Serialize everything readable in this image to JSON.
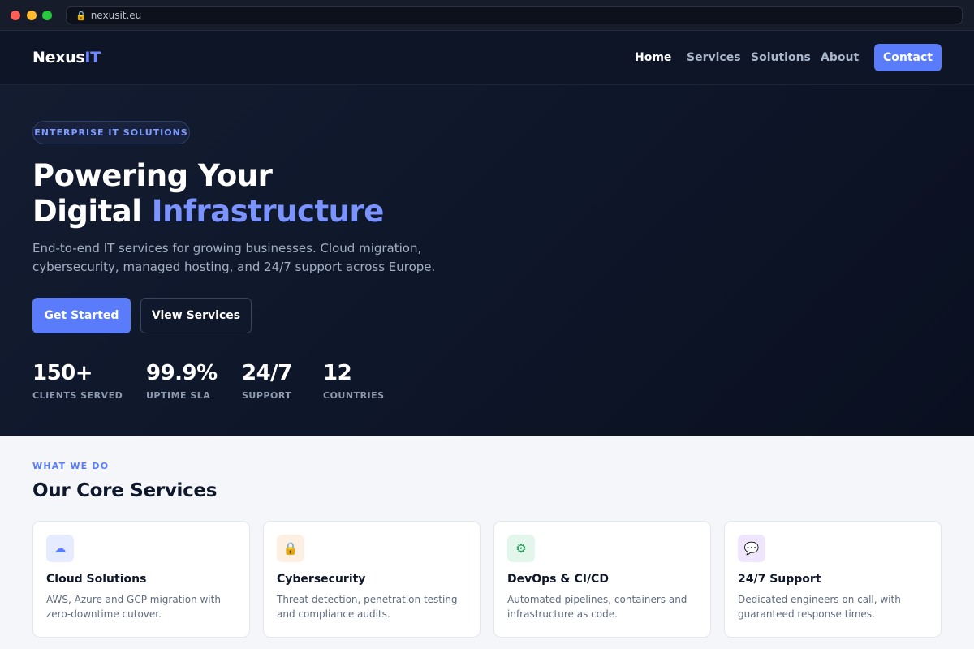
{
  "browser": {
    "url": "nexusit.eu"
  },
  "nav": {
    "logo_main": "Nexus",
    "logo_accent": "IT",
    "links": [
      {
        "label": "Home",
        "active": true
      },
      {
        "label": "Services",
        "active": false
      },
      {
        "label": "Solutions",
        "active": false
      },
      {
        "label": "About",
        "active": false
      }
    ],
    "cta": "Contact"
  },
  "hero": {
    "badge": "ENTERPRISE IT SOLUTIONS",
    "headline_line1": "Powering Your",
    "headline_line2_plain": "Digital ",
    "headline_line2_accent": "Infrastructure",
    "lead": "End-to-end IT services for growing businesses. Cloud migration, cybersecurity, managed hosting, and 24/7 support across Europe.",
    "primary_button": "Get Started",
    "secondary_button": "View Services",
    "stats": [
      {
        "value": "150+",
        "label": "CLIENTS SERVED"
      },
      {
        "value": "99.9%",
        "label": "UPTIME SLA"
      },
      {
        "value": "24/7",
        "label": "SUPPORT"
      },
      {
        "value": "12",
        "label": "COUNTRIES"
      }
    ]
  },
  "services": {
    "eyebrow": "WHAT WE DO",
    "title": "Our Core Services",
    "cards": [
      {
        "icon": "cloud-icon",
        "glyph": "☁",
        "icon_bg": "#e6ebff",
        "icon_color": "#5b7cfa",
        "title": "Cloud Solutions",
        "description": "AWS, Azure and GCP migration with zero-downtime cutover."
      },
      {
        "icon": "lock-icon",
        "glyph": "🔒",
        "icon_bg": "#fdefe2",
        "icon_color": "#e0902a",
        "title": "Cybersecurity",
        "description": "Threat detection, penetration testing and compliance audits."
      },
      {
        "icon": "gear-icon",
        "glyph": "⚙",
        "icon_bg": "#e3f6ec",
        "icon_color": "#1f9d57",
        "title": "DevOps & CI/CD",
        "description": "Automated pipelines, containers and infrastructure as code."
      },
      {
        "icon": "speech-bubble-icon",
        "glyph": "💬",
        "icon_bg": "#efe6fd",
        "icon_color": "#8b5cf6",
        "title": "24/7 Support",
        "description": "Dedicated engineers on call, with guaranteed response times."
      }
    ]
  }
}
